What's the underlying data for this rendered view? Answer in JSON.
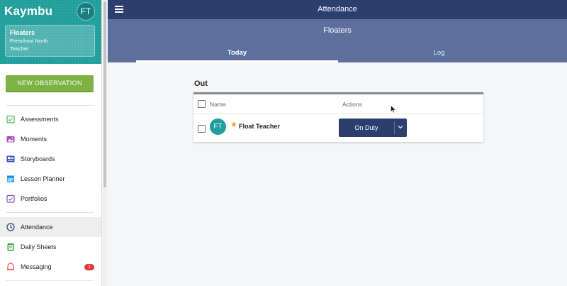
{
  "app": {
    "logo": "Kaymbu",
    "user_initials": "FT"
  },
  "class_card": {
    "title": "Floaters",
    "school": "Preschool North",
    "role": "Teacher"
  },
  "sidebar": {
    "new_observation": "NEW OBSERVATION",
    "items": [
      {
        "label": "Assessments",
        "icon": "assessments-icon"
      },
      {
        "label": "Moments",
        "icon": "moments-icon"
      },
      {
        "label": "Storyboards",
        "icon": "storyboards-icon"
      },
      {
        "label": "Lesson Planner",
        "icon": "lesson-planner-icon"
      },
      {
        "label": "Portfolios",
        "icon": "portfolios-icon"
      },
      {
        "label": "Attendance",
        "icon": "clock-icon"
      },
      {
        "label": "Daily Sheets",
        "icon": "daily-sheets-icon"
      },
      {
        "label": "Messaging",
        "icon": "messaging-icon",
        "badge": "1"
      }
    ]
  },
  "header": {
    "title": "Attendance",
    "subtitle": "Floaters",
    "tabs": [
      {
        "label": "Today",
        "active": true
      },
      {
        "label": "Log",
        "active": false
      }
    ]
  },
  "main": {
    "section_title": "Out",
    "columns": [
      "Name",
      "Actions"
    ],
    "rows": [
      {
        "initials": "FT",
        "name": "Float Teacher",
        "status": "On Duty"
      }
    ]
  },
  "colors": {
    "brand_teal": "#1f9e9c",
    "header_navy": "#2b3e6e",
    "subheader": "#5d6f9d",
    "green_button": "#7cb342",
    "badge_red": "#e53935",
    "star": "#f0a020"
  }
}
